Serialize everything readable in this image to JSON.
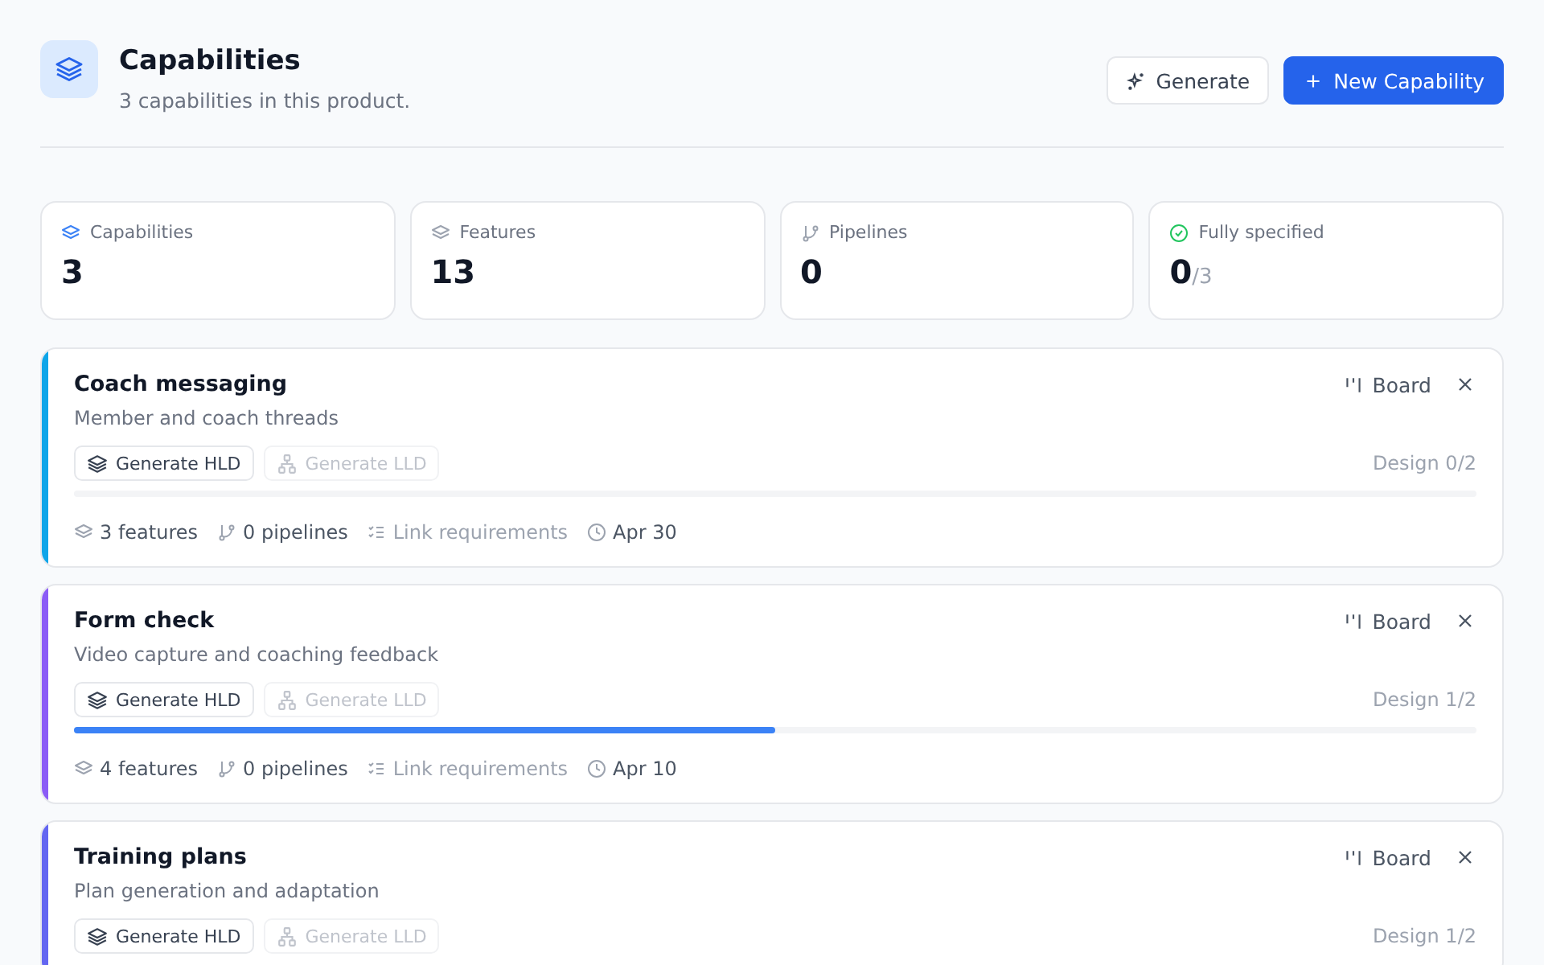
{
  "header": {
    "title": "Capabilities",
    "subtitle": "3 capabilities in this product.",
    "actions": [
      {
        "kind": "secondary",
        "label": "Generate"
      },
      {
        "kind": "primary",
        "label": "New Capability"
      }
    ]
  },
  "stats": [
    {
      "kind": "capabilities",
      "label": "Capabilities",
      "value": "3"
    },
    {
      "kind": "features",
      "label": "Features",
      "value": "13"
    },
    {
      "kind": "pipelines",
      "label": "Pipelines",
      "value": "0"
    },
    {
      "kind": "specified",
      "label": "Fully specified",
      "value": "0",
      "total": "/3"
    }
  ],
  "capabilities": [
    {
      "title": "Coach messaging",
      "description": "Member and coach threads",
      "color": "#0ea5e9",
      "board": "Board",
      "buttons": [
        {
          "kind": "hld",
          "label": "Generate HLD",
          "disabled": false
        },
        {
          "kind": "lld",
          "label": "Generate LLD",
          "disabled": true
        }
      ],
      "progress_label": "Design 0/2",
      "level": 0,
      "meta": [
        {
          "kind": "features",
          "text": "3 features"
        },
        {
          "kind": "pipelines",
          "text": "0 pipelines"
        },
        {
          "kind": "requirements",
          "text": "Link requirements"
        },
        {
          "kind": "date",
          "text": "Apr 30"
        }
      ]
    },
    {
      "title": "Form check",
      "description": "Video capture and coaching feedback",
      "color": "#8b5cf6",
      "board": "Board",
      "buttons": [
        {
          "kind": "hld",
          "label": "Generate HLD",
          "disabled": false
        },
        {
          "kind": "lld",
          "label": "Generate LLD",
          "disabled": true
        }
      ],
      "progress_label": "Design 1/2",
      "level": 0.5,
      "meta": [
        {
          "kind": "features",
          "text": "4 features"
        },
        {
          "kind": "pipelines",
          "text": "0 pipelines"
        },
        {
          "kind": "requirements",
          "text": "Link requirements"
        },
        {
          "kind": "date",
          "text": "Apr 10"
        }
      ]
    },
    {
      "title": "Training plans",
      "description": "Plan generation and adaptation",
      "color": "#6366f1",
      "board": "Board",
      "buttons": [
        {
          "kind": "hld",
          "label": "Generate HLD",
          "disabled": false
        },
        {
          "kind": "lld",
          "label": "Generate LLD",
          "disabled": true
        }
      ],
      "progress_label": "Design 1/2"
    }
  ]
}
